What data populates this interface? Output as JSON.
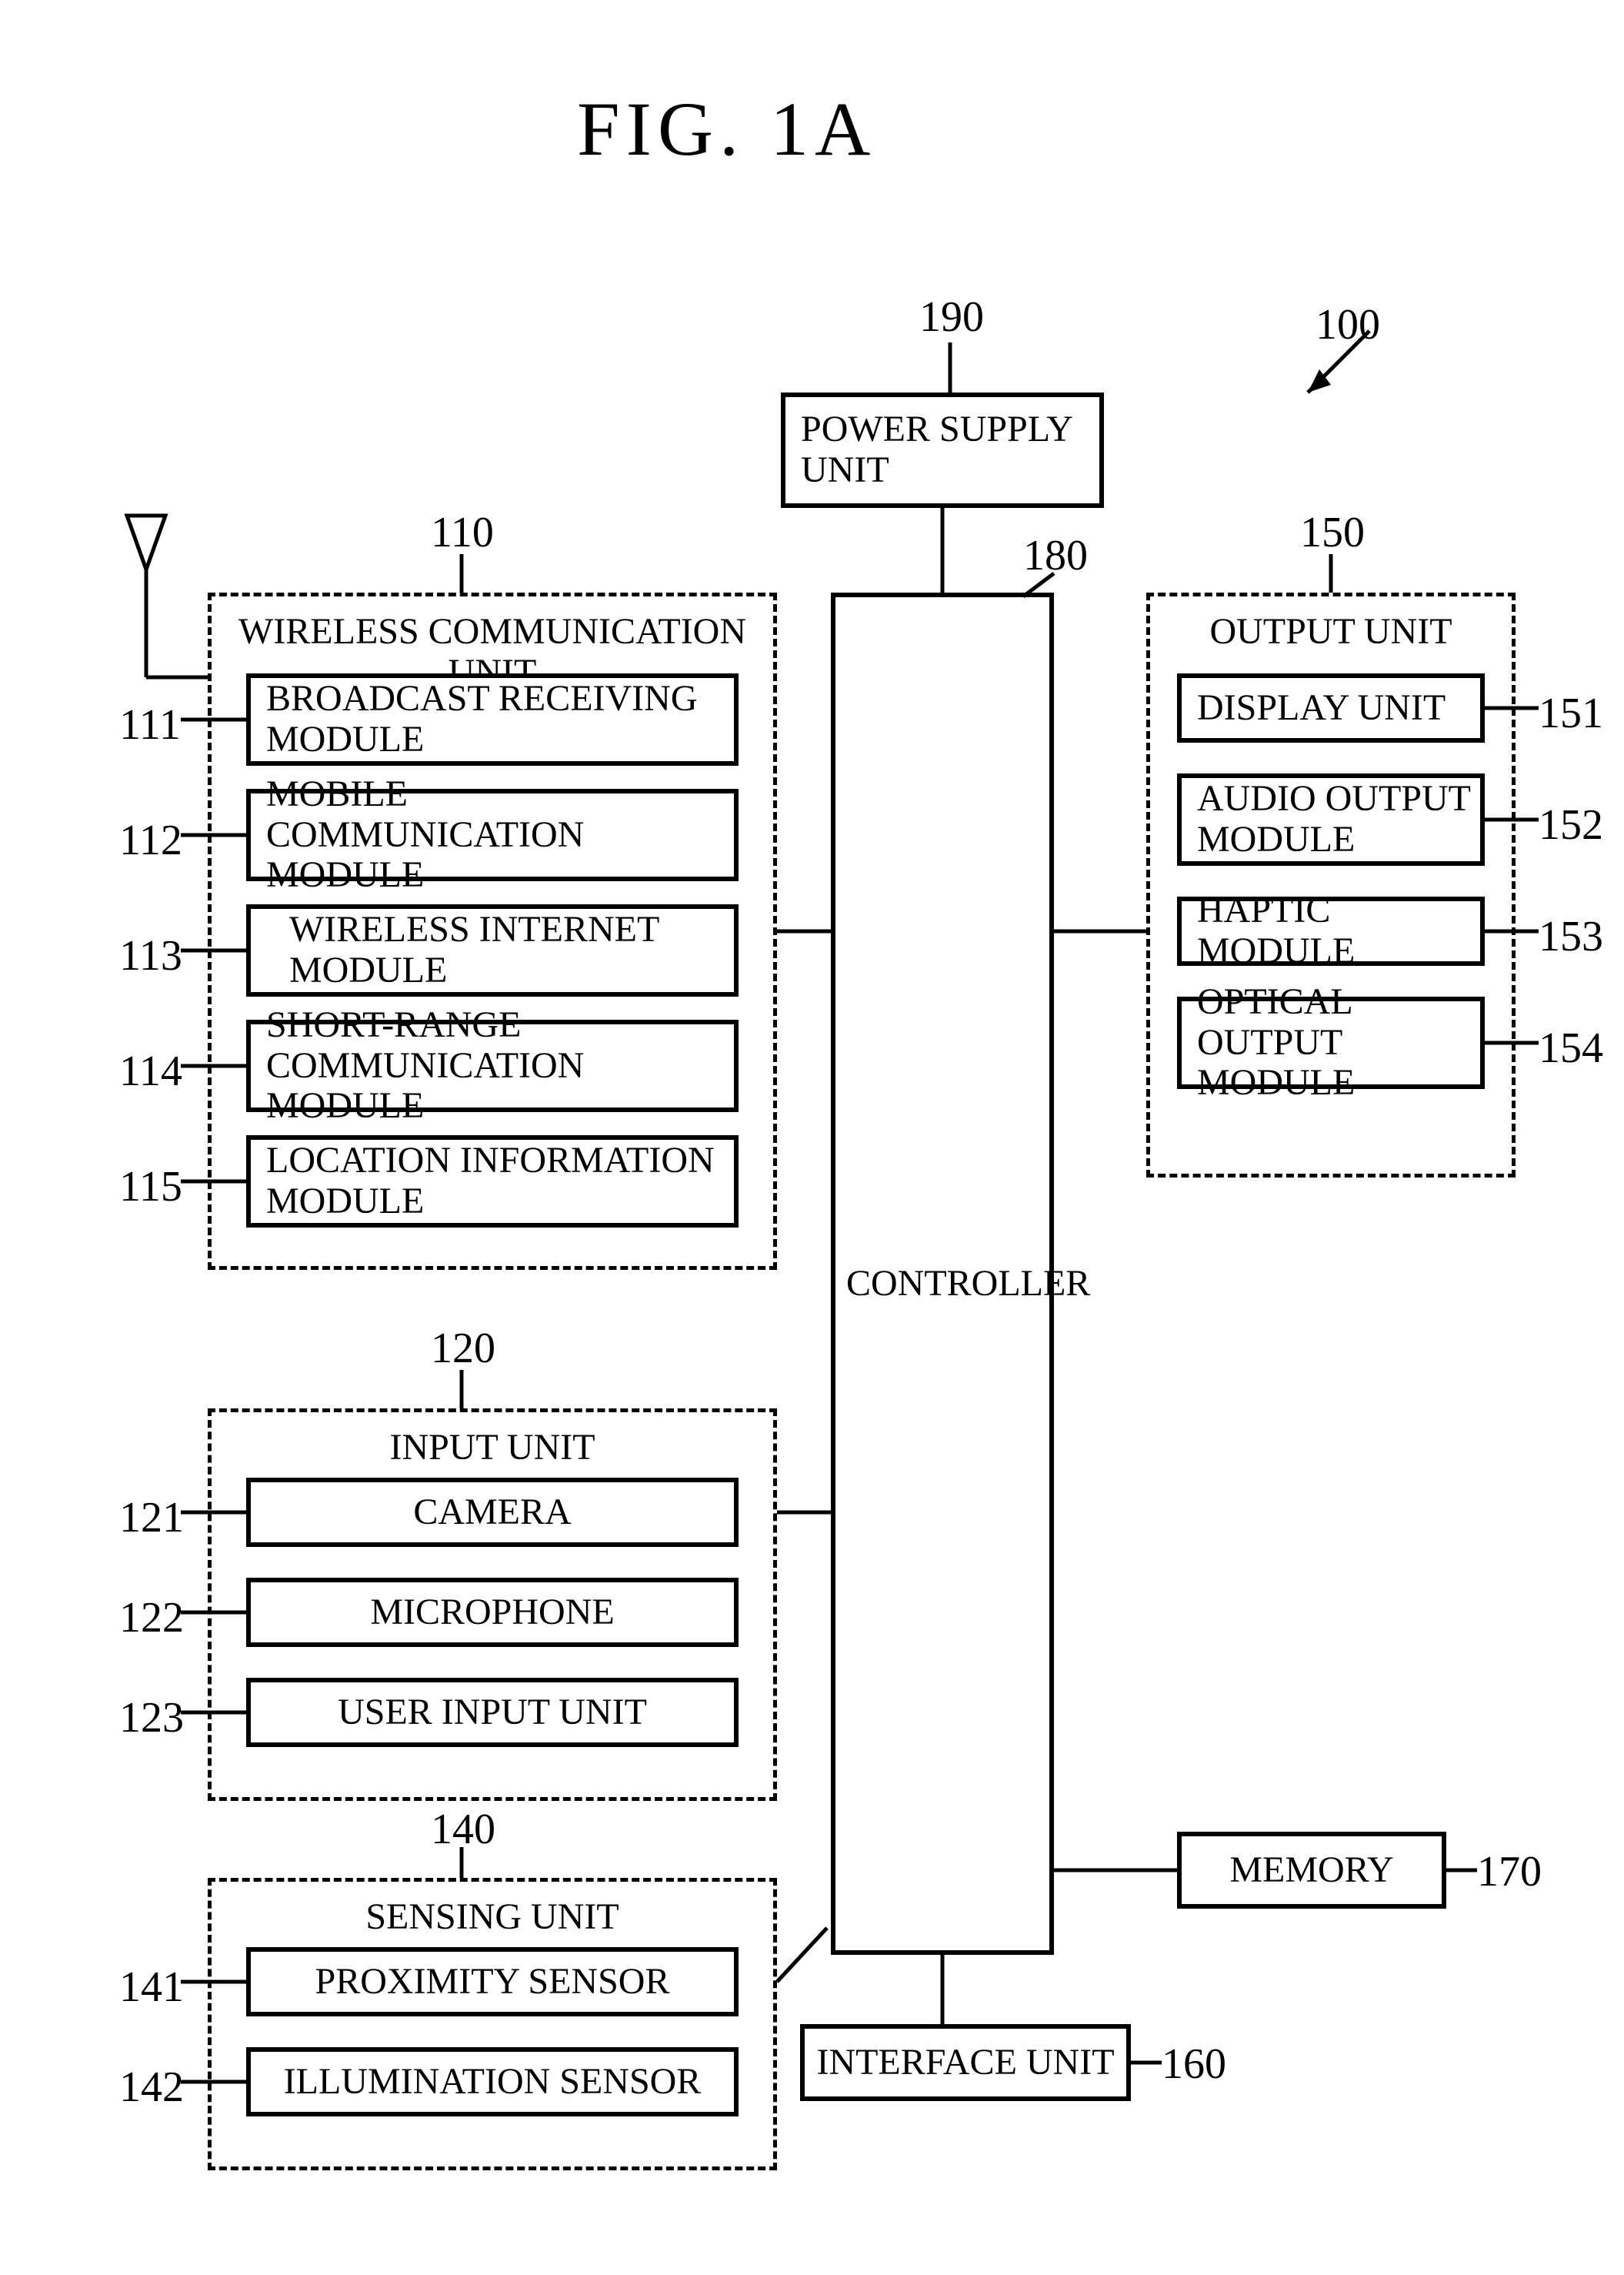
{
  "figure_title": "FIG. 1A",
  "refs": {
    "r100": "100",
    "r190": "190",
    "r180": "180",
    "r110": "110",
    "r111": "111",
    "r112": "112",
    "r113": "113",
    "r114": "114",
    "r115": "115",
    "r120": "120",
    "r121": "121",
    "r122": "122",
    "r123": "123",
    "r140": "140",
    "r141": "141",
    "r142": "142",
    "r150": "150",
    "r151": "151",
    "r152": "152",
    "r153": "153",
    "r154": "154",
    "r170": "170",
    "r160": "160"
  },
  "blocks": {
    "power_supply": "POWER SUPPLY\nUNIT",
    "controller": "CONTROLLER",
    "interface_unit": "INTERFACE UNIT",
    "memory": "MEMORY",
    "wireless_title": "WIRELESS COMMUNICATION UNIT",
    "w111": "BROADCAST RECEIVING\nMODULE",
    "w112": "MOBILE COMMUNICATION\nMODULE",
    "w113": "WIRELESS INTERNET\nMODULE",
    "w114": "SHORT-RANGE\nCOMMUNICATION MODULE",
    "w115": "LOCATION INFORMATION\nMODULE",
    "input_title": "INPUT UNIT",
    "i121": "CAMERA",
    "i122": "MICROPHONE",
    "i123": "USER INPUT UNIT",
    "sensing_title": "SENSING UNIT",
    "s141": "PROXIMITY SENSOR",
    "s142": "ILLUMINATION SENSOR",
    "output_title": "OUTPUT UNIT",
    "o151": "DISPLAY UNIT",
    "o152": "AUDIO OUTPUT\nMODULE",
    "o153": "HAPTIC MODULE",
    "o154": "OPTICAL OUTPUT\nMODULE"
  }
}
